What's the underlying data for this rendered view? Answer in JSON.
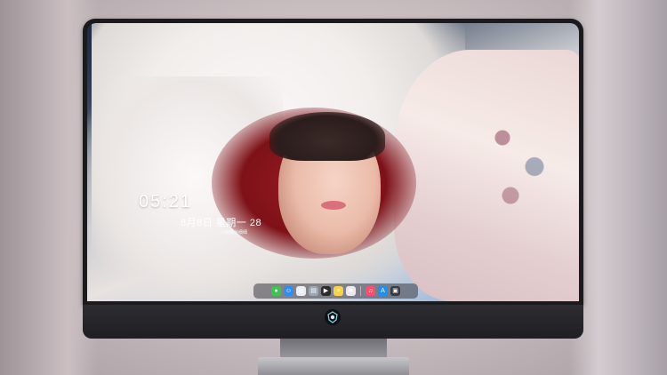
{
  "lockscreen": {
    "time": "05:21",
    "date": "8月8日 星期一 28",
    "subline": "小雨细丝细细"
  },
  "dock": {
    "items": [
      {
        "name": "messages-icon",
        "glyph": "●",
        "color": "#3cc552"
      },
      {
        "name": "finder-icon",
        "glyph": "☺",
        "color": "#2f8ef0"
      },
      {
        "name": "safari-icon",
        "glyph": "◎",
        "color": "#e9eef5"
      },
      {
        "name": "preview-icon",
        "glyph": "▤",
        "color": "#9aa6b5"
      },
      {
        "name": "finalcut-icon",
        "glyph": "▶",
        "color": "#2b2b2b"
      },
      {
        "name": "notes-icon",
        "glyph": "≡",
        "color": "#f7d34a"
      },
      {
        "name": "photos-icon",
        "glyph": "❀",
        "color": "#e9e9ee"
      },
      {
        "name": "music-icon",
        "glyph": "♫",
        "color": "#fb4d6e"
      },
      {
        "name": "appstore-icon",
        "glyph": "A",
        "color": "#1f8ef5"
      },
      {
        "name": "screenshot-icon",
        "glyph": "▣",
        "color": "#3a3a40"
      }
    ]
  },
  "brand": {
    "logo_icon": "kirin-logo-icon",
    "accent": "#7fd6e8"
  }
}
